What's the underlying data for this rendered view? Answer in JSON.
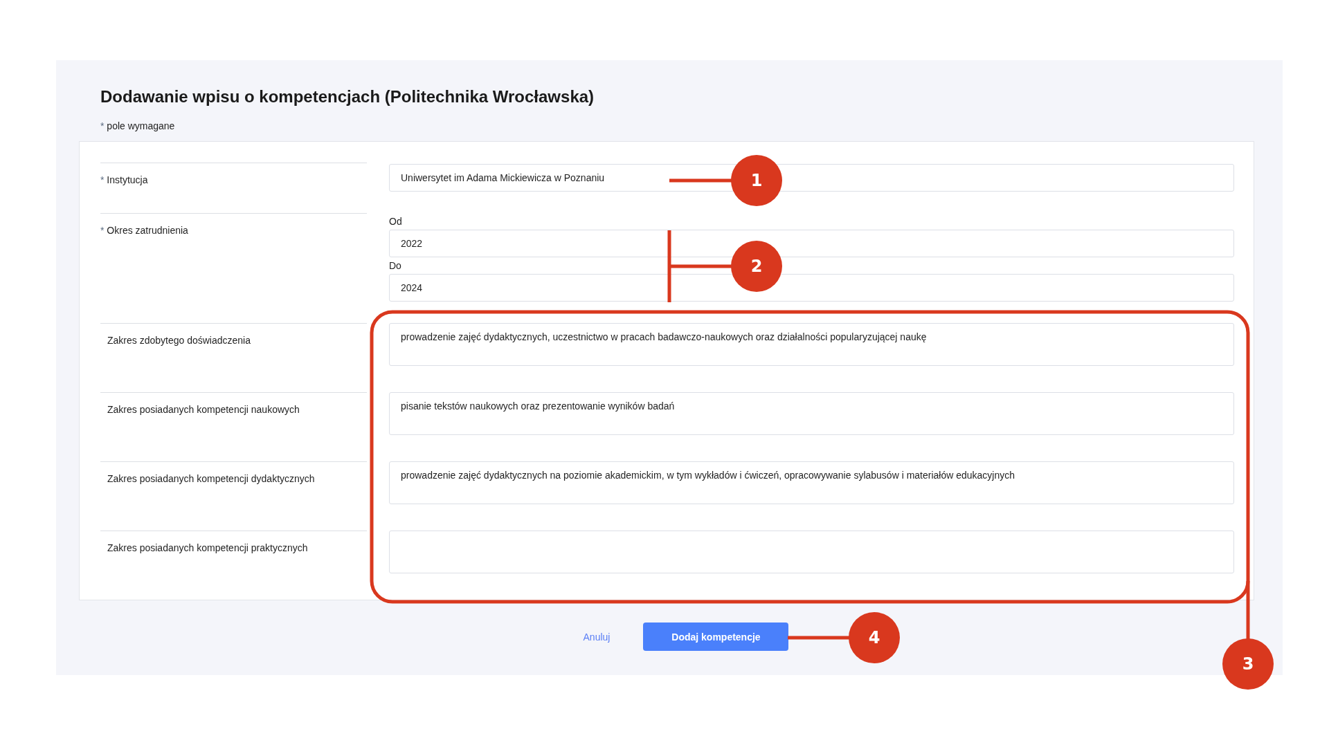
{
  "title": "Dodawanie wpisu o kompetencjach (Politechnika Wrocławska)",
  "required_mark": "*",
  "required_note": "pole wymagane",
  "fields": [
    {
      "kind": "text",
      "label": "Instytucja",
      "required": true,
      "value": "Uniwersytet im Adama Mickiewicza w Poznaniu"
    },
    {
      "kind": "range",
      "label": "Okres zatrudnienia",
      "required": true,
      "parts": [
        {
          "label": "Od",
          "value": "2022"
        },
        {
          "label": "Do",
          "value": "2024"
        }
      ]
    },
    {
      "kind": "textarea",
      "label": "Zakres zdobytego doświadczenia",
      "required": false,
      "value": "prowadzenie zajęć dydaktycznych, uczestnictwo w pracach badawczo-naukowych oraz działalności popularyzującej naukę"
    },
    {
      "kind": "textarea",
      "label": "Zakres posiadanych kompetencji naukowych",
      "required": false,
      "value": "pisanie tekstów naukowych oraz prezentowanie wyników badań"
    },
    {
      "kind": "textarea",
      "label": "Zakres posiadanych kompetencji dydaktycznych",
      "required": false,
      "value": "prowadzenie zajęć dydaktycznych na poziomie akademickim, w tym wykładów i ćwiczeń, opracowywanie sylabusów i materiałów edukacyjnych"
    },
    {
      "kind": "textarea",
      "label": "Zakres posiadanych kompetencji praktycznych",
      "required": false
    }
  ],
  "actions": [
    {
      "kind": "link",
      "label": "Anuluj"
    },
    {
      "kind": "primary",
      "label": "Dodaj kompetencje"
    }
  ],
  "annotations": [
    {
      "label": "1"
    },
    {
      "label": "2"
    },
    {
      "label": "3"
    },
    {
      "label": "4"
    }
  ]
}
